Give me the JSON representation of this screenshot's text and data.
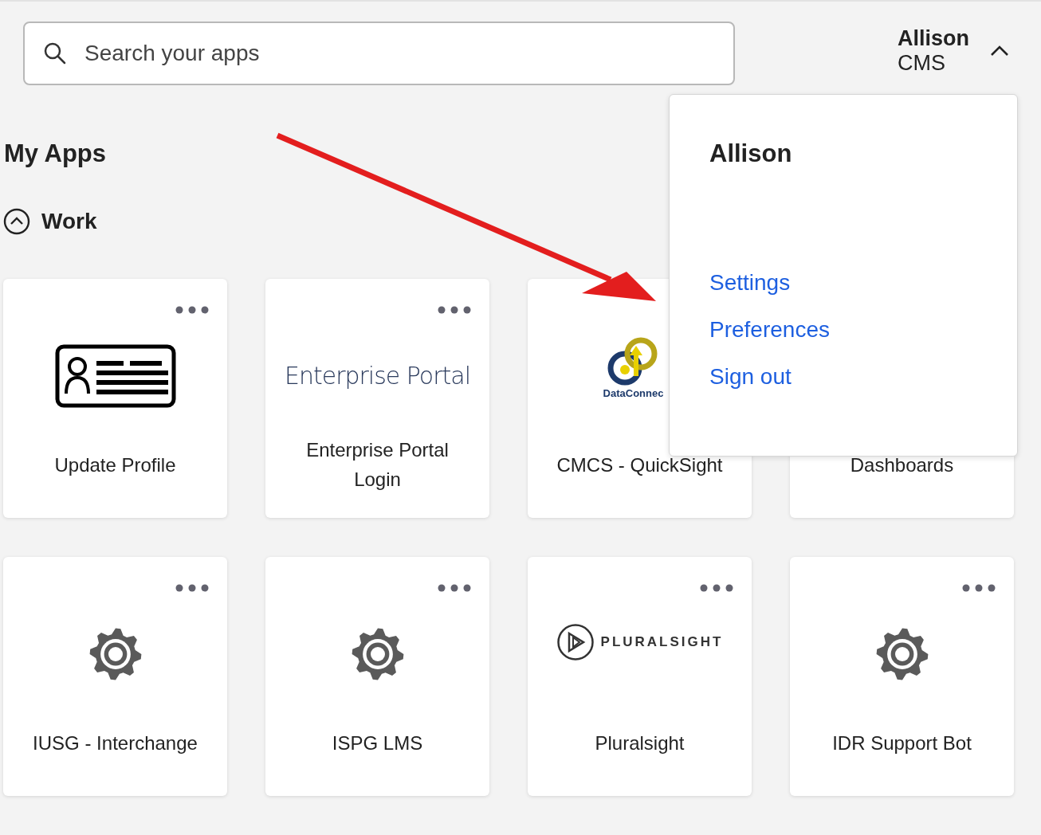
{
  "search": {
    "placeholder": "Search your apps"
  },
  "user_menu": {
    "name": "Allison",
    "org": "CMS",
    "expanded": true,
    "dropdown": {
      "heading": "Allison",
      "items": [
        "Settings",
        "Preferences",
        "Sign out"
      ]
    }
  },
  "heading": "My Apps",
  "section": {
    "label": "Work",
    "expanded": true
  },
  "apps": [
    {
      "kind": "id-card",
      "title": "Update Profile",
      "more_menu": true
    },
    {
      "kind": "wordmark",
      "logo_text": "Enterprise Portal",
      "title": "Enterprise Portal Login",
      "more_menu": true
    },
    {
      "kind": "dataconnect",
      "logo_text": "DataConnec",
      "title": "CMCS - QuickSight",
      "more_menu": false
    },
    {
      "kind": "none",
      "title": "Dashboards",
      "more_menu": false
    },
    {
      "kind": "gear",
      "title": "IUSG - Interchange",
      "more_menu": true
    },
    {
      "kind": "gear",
      "title": "ISPG LMS",
      "more_menu": true
    },
    {
      "kind": "pluralsight",
      "logo_text": "PLURALSIGHT",
      "title": "Pluralsight",
      "more_menu": true
    },
    {
      "kind": "gear",
      "title": "IDR Support Bot",
      "more_menu": true
    }
  ]
}
